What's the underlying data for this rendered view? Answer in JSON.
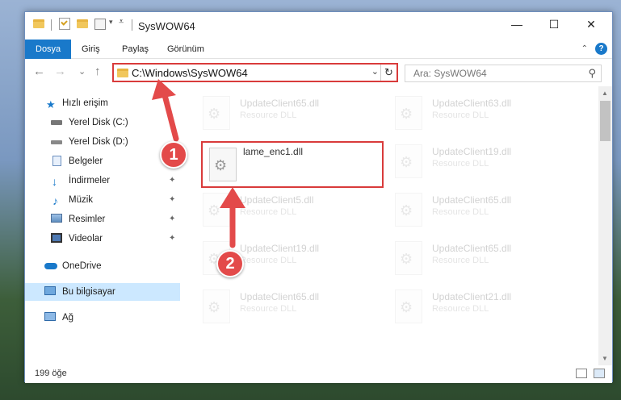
{
  "window": {
    "title": "SysWOW64",
    "controls": {
      "minimize": "—",
      "maximize": "☐",
      "close": "✕"
    }
  },
  "ribbon": {
    "tabs": [
      "Dosya",
      "Giriş",
      "Paylaş",
      "Görünüm"
    ],
    "help": "?",
    "collapse": "⌃"
  },
  "nav": {
    "back": "←",
    "forward": "→",
    "recent": "⌄",
    "up": "↑",
    "address": "C:\\Windows\\SysWOW64",
    "address_dropdown": "⌄",
    "refresh": "↻",
    "search_placeholder": "Ara: SysWOW64"
  },
  "sidebar": {
    "items": [
      {
        "label": "Hızlı erişim",
        "icon": "star-icon"
      },
      {
        "label": "Yerel Disk (C:)",
        "icon": "drive-icon"
      },
      {
        "label": "Yerel Disk (D:)",
        "icon": "drive-icon"
      },
      {
        "label": "Belgeler",
        "icon": "documents-icon"
      },
      {
        "label": "İndirmeler",
        "icon": "download-icon"
      },
      {
        "label": "Müzik",
        "icon": "music-icon"
      },
      {
        "label": "Resimler",
        "icon": "pictures-icon"
      },
      {
        "label": "Videolar",
        "icon": "videos-icon"
      },
      {
        "label": "OneDrive",
        "icon": "cloud-icon"
      },
      {
        "label": "Bu bilgisayar",
        "icon": "computer-icon"
      },
      {
        "label": "Ağ",
        "icon": "network-icon"
      }
    ],
    "pin": "📌"
  },
  "files": [
    {
      "name": "UpdateClient65.dll",
      "type": "Resource DLL"
    },
    {
      "name": "UpdateClient63.dll",
      "type": "Resource DLL"
    },
    {
      "name": "lame_enc1.dll",
      "type": ""
    },
    {
      "name": "UpdateClient19.dll",
      "type": "Resource DLL"
    },
    {
      "name": "UpdateClient5.dll",
      "type": "Resource DLL"
    },
    {
      "name": "UpdateClient65.dll",
      "type": "Resource DLL"
    },
    {
      "name": "UpdateClient19.dll",
      "type": "Resource DLL"
    },
    {
      "name": "UpdateClient65.dll",
      "type": "Resource DLL"
    },
    {
      "name": "UpdateClient65.dll",
      "type": "Resource DLL"
    },
    {
      "name": "UpdateClient21.dll",
      "type": "Resource DLL"
    }
  ],
  "status": {
    "count": "199 öğe"
  },
  "annotations": {
    "step1": "1",
    "step2": "2"
  },
  "colors": {
    "accent": "#1979ca",
    "highlight": "#d93b3b",
    "arrow": "#e34a4a",
    "selected": "#cce8ff"
  }
}
